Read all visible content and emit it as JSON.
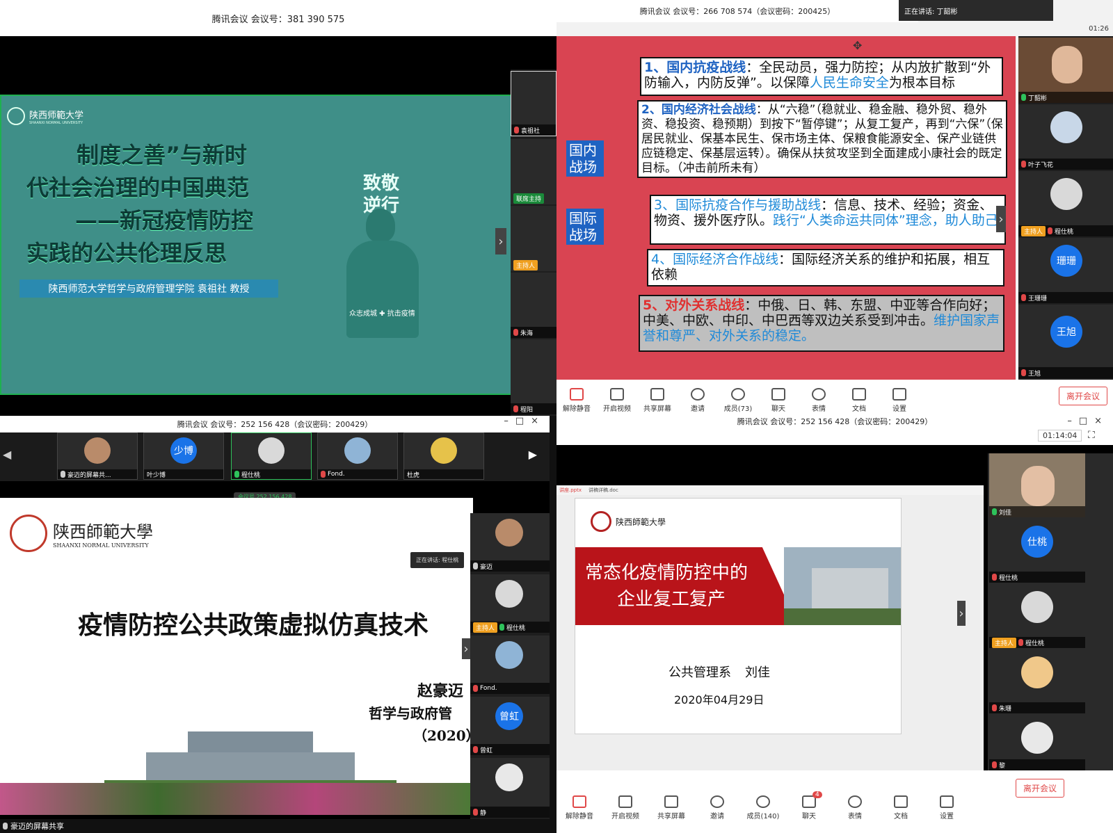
{
  "q1": {
    "title": "腾讯会议 会议号：381 390 575",
    "slide": {
      "university": "陕西师範大学",
      "university_en": "SHAANXI NORMAL UNIVERSITY",
      "title_lines": [
        "制度之善”与新时",
        "代社会治理的中国典范",
        "——新冠疫情防控",
        "实践的公共伦理反思"
      ],
      "author": "陕西师范大学哲学与政府管理学院  袁祖社  教授",
      "poster_big": "致敬逆行者",
      "poster_small": "众志成城 ✚ 抗击疫情"
    },
    "side": [
      {
        "name": "袁祖社",
        "badge": ""
      },
      {
        "name": "",
        "badge": "联席主持"
      },
      {
        "name": "",
        "badge": "主持人"
      },
      {
        "name": "朱海",
        "badge": ""
      },
      {
        "name": "程阳",
        "badge": ""
      }
    ]
  },
  "q2": {
    "title": "腾讯会议 会议号：266 708 574（会议密码：200425）",
    "speaking": "正在讲话: 丁韶彬",
    "timer": "01:26",
    "labels": {
      "domestic": "国内战场",
      "international": "国际战场"
    },
    "boxes": [
      {
        "head": "1、国内抗疫战线",
        "text": "：全民动员，强力防控；从内放扩散到“外防输入，内防反弹”。以保障",
        "em": "人民生命安全",
        "tail": "为根本目标"
      },
      {
        "head": "2、国内经济社会战线",
        "text": "：从“六稳”（稳就业、稳金融、稳外贸、稳外资、稳投资、稳预期）到按下“暂停键”；从复工复产，再到“六保”（保居民就业、保基本民生、保市场主体、保粮食能源安全、保产业链供应链稳定、保基层运转）。确保从扶贫攻坚到全面建成小康社会的既定目标。（冲击前所未有）"
      },
      {
        "head": "3、国际抗疫合作与援助战线",
        "text": "：信息、技术、经验；资金、物资、援外医疗队。",
        "em": "践行“人类命运共同体”理念，助人助己"
      },
      {
        "head": "4、国际经济合作战线",
        "text": "：国际经济关系的维护和拓展，相互依赖"
      },
      {
        "head": "5、对外关系战线",
        "text": "：中俄、日、韩、东盟、中亚等合作向好；中美、中欧、中印、中巴西等双边关系受到冲击。",
        "em": "维护国家声誉和尊严、对外关系的稳定。"
      }
    ],
    "side": [
      {
        "name": "丁韶彬",
        "avatar": ""
      },
      {
        "name": "叶子飞花",
        "avatar": ""
      },
      {
        "name": "程仕桃",
        "avatar": "",
        "badge": "主持人"
      },
      {
        "name": "王珊珊",
        "avatar": "珊珊"
      },
      {
        "name": "王旭",
        "avatar": "王旭"
      }
    ],
    "toolbar": [
      "解除静音",
      "开启视频",
      "共享屏幕",
      "邀请",
      "成员(73)",
      "聊天",
      "表情",
      "文档",
      "设置"
    ],
    "leave": "离开会议"
  },
  "q3": {
    "title": "腾讯会议 会议号：252 156 428（会议密码：200429）",
    "thumbs": [
      {
        "name": "豪迈的屏幕共...",
        "avatar": ""
      },
      {
        "name": "叶少博",
        "avatar": "少博"
      },
      {
        "name": "程仕桃",
        "avatar": ""
      },
      {
        "name": "Fond.",
        "avatar": ""
      },
      {
        "name": "杜虎",
        "avatar": ""
      }
    ],
    "pill": "会议号 252 156 428",
    "speaking": "正在讲话: 程仕桃",
    "slide": {
      "university": "陕西師範大學",
      "university_en": "SHAANXI NORMAL UNIVERSITY",
      "title": "疫情防控公共政策虚拟仿真技术",
      "author": "赵豪迈",
      "dept": "哲学与政府管",
      "year": "（2020）"
    },
    "side": [
      {
        "name": "豪迈",
        "avatar": ""
      },
      {
        "name": "程仕桃",
        "avatar": "",
        "badge": "主持人"
      },
      {
        "name": "Fond.",
        "avatar": ""
      },
      {
        "name": "曾虹",
        "avatar": "曾虹"
      },
      {
        "name": "静",
        "avatar": ""
      }
    ],
    "footer": "豪迈的屏幕共享"
  },
  "q4": {
    "title": "腾讯会议 会议号：252 156 428（会议密码：200429）",
    "timer": "01:14:04",
    "tabs": [
      "讲座.pptx",
      "讲稿详稿.doc"
    ],
    "slide": {
      "university": "陕西師範大學",
      "title_line1": "常态化疫情防控中的",
      "title_line2": "企业复工复产",
      "dept": "公共管理系",
      "name": "刘佳",
      "date": "2020年04月29日"
    },
    "side": [
      {
        "name": "刘佳",
        "avatar": ""
      },
      {
        "name": "程仕桃",
        "avatar": "仕桃"
      },
      {
        "name": "程仕桃",
        "avatar": "",
        "badge": "主持人"
      },
      {
        "name": "朱珊",
        "avatar": ""
      },
      {
        "name": "黎",
        "avatar": ""
      }
    ],
    "toolbar": [
      "解除静音",
      "开启视频",
      "共享屏幕",
      "邀请",
      "成员(140)",
      "聊天",
      "表情",
      "文档",
      "设置"
    ],
    "chat_badge": "4",
    "leave": "离开会议"
  }
}
